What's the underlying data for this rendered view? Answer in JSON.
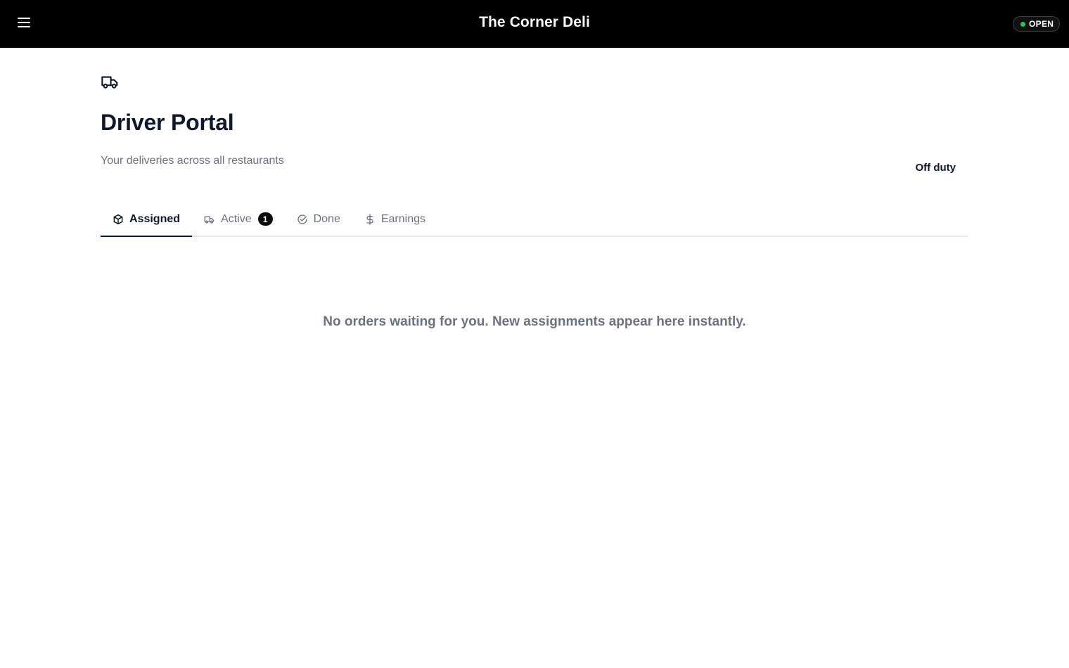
{
  "header": {
    "title": "The Corner Deli",
    "menu_icon": "hamburger-menu-icon",
    "status": {
      "label": "OPEN",
      "color": "#22c55e"
    }
  },
  "page": {
    "icon": "truck-icon",
    "title": "Driver Portal",
    "subtitle": "Your deliveries across all restaurants",
    "duty_status": "Off duty"
  },
  "tabs": [
    {
      "label": "Assigned",
      "icon": "package-icon",
      "active": true
    },
    {
      "label": "Active",
      "icon": "truck-icon",
      "badge": "1",
      "active": false
    },
    {
      "label": "Done",
      "icon": "check-circle-icon",
      "active": false
    },
    {
      "label": "Earnings",
      "icon": "dollar-icon",
      "active": false
    }
  ],
  "empty_state": {
    "message": "No orders waiting for you. New assignments appear here instantly."
  }
}
